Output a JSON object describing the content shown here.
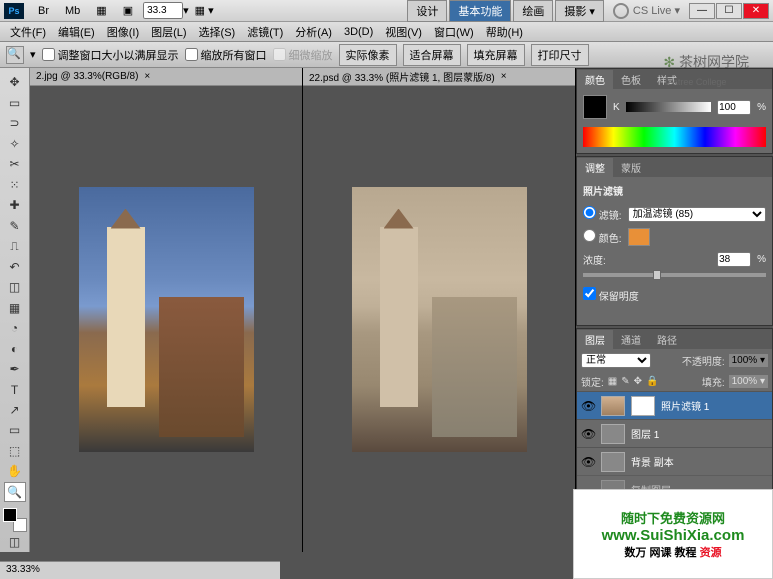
{
  "titlebar": {
    "ps": "Ps",
    "zoom": "33.3",
    "zoomSuffix": "▾",
    "btns": [
      "Br",
      "Mb",
      "▦",
      "▣"
    ],
    "workspace": {
      "design": "设计",
      "basic": "基本功能",
      "paint": "绘画",
      "photo": "摄影 ▾"
    },
    "cslive": "CS Live ▾"
  },
  "menu": {
    "items": [
      "文件(F)",
      "编辑(E)",
      "图像(I)",
      "图层(L)",
      "选择(S)",
      "滤镜(T)",
      "分析(A)",
      "3D(D)",
      "视图(V)",
      "窗口(W)",
      "帮助(H)"
    ]
  },
  "options": {
    "cb1": "调整窗口大小以满屏显示",
    "cb2": "缩放所有窗口",
    "cb3": "细微缩放",
    "btn1": "实际像素",
    "btn2": "适合屏幕",
    "btn3": "填充屏幕",
    "btn4": "打印尺寸"
  },
  "docs": {
    "left": {
      "title": "2.jpg @ 33.3%(RGB/8)"
    },
    "right": {
      "title": "22.psd @ 33.3% (照片滤镜 1, 图层蒙版/8)"
    }
  },
  "colorPanel": {
    "tabs": [
      "颜色",
      "色板",
      "样式"
    ],
    "label": "K",
    "value": "100",
    "pct": "%"
  },
  "adjustPanel": {
    "tabs": [
      "调整",
      "蒙版"
    ],
    "title": "照片滤镜",
    "filterLabel": "滤镜:",
    "filterSelect": "加温滤镜 (85)",
    "colorLabel": "颜色:",
    "densityLabel": "浓度:",
    "densityValue": "38",
    "pct": "%",
    "preserve": "保留明度"
  },
  "layersPanel": {
    "tabs": [
      "图层",
      "通道",
      "路径"
    ],
    "blend": "正常",
    "opacityLabel": "不透明度:",
    "opacityValue": "100% ▾",
    "lockLabel": "锁定:",
    "fillLabel": "填充:",
    "fillValue": "100% ▾",
    "layers": [
      {
        "name": "照片滤镜 1",
        "selected": true
      },
      {
        "name": "图层 1",
        "selected": false
      },
      {
        "name": "背景 副本",
        "selected": false
      }
    ],
    "copyLayer": "复制图层"
  },
  "status": {
    "zoom": "33.33%"
  },
  "watermark": {
    "top": "茶树网学院",
    "topEn": "Teatree College",
    "promo1": "随时下免费资源网",
    "promo2": "www.SuiShiXia.com",
    "promo3a": "数万 网课 教程 ",
    "promo3b": "资源"
  },
  "tools": [
    "▱",
    "▭",
    "◫",
    "✂",
    "✎",
    "✐",
    "⚕",
    "✜",
    "✏",
    "▤",
    "◔",
    "✒",
    "↔",
    "⬚",
    "T",
    "◇",
    "▭",
    "✋",
    "🔍"
  ]
}
